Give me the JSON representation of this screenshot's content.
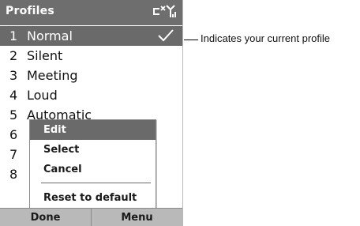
{
  "titlebar": {
    "title": "Profiles",
    "icons": [
      "connectivity-icon",
      "signal-strength-icon"
    ]
  },
  "profiles": [
    {
      "num": "1",
      "label": "Normal",
      "selected": true,
      "check_icon": "checkmark-icon"
    },
    {
      "num": "2",
      "label": "Silent"
    },
    {
      "num": "3",
      "label": "Meeting"
    },
    {
      "num": "4",
      "label": "Loud"
    },
    {
      "num": "5",
      "label": "Automatic"
    },
    {
      "num": "6",
      "label": ""
    },
    {
      "num": "7",
      "label": ""
    },
    {
      "num": "8",
      "label": ""
    }
  ],
  "context_menu": {
    "items": [
      {
        "label": "Edit",
        "highlighted": true
      },
      {
        "label": "Select"
      },
      {
        "label": "Cancel"
      },
      {
        "label": "Reset to default"
      }
    ]
  },
  "softkeys": {
    "left": "Done",
    "right": "Menu"
  },
  "callout": {
    "text": "Indicates your current profile"
  },
  "colors": {
    "bar": "#6e6e6e",
    "selection": "#6a6a6a",
    "softkey_bg": "#b9b9b9"
  }
}
